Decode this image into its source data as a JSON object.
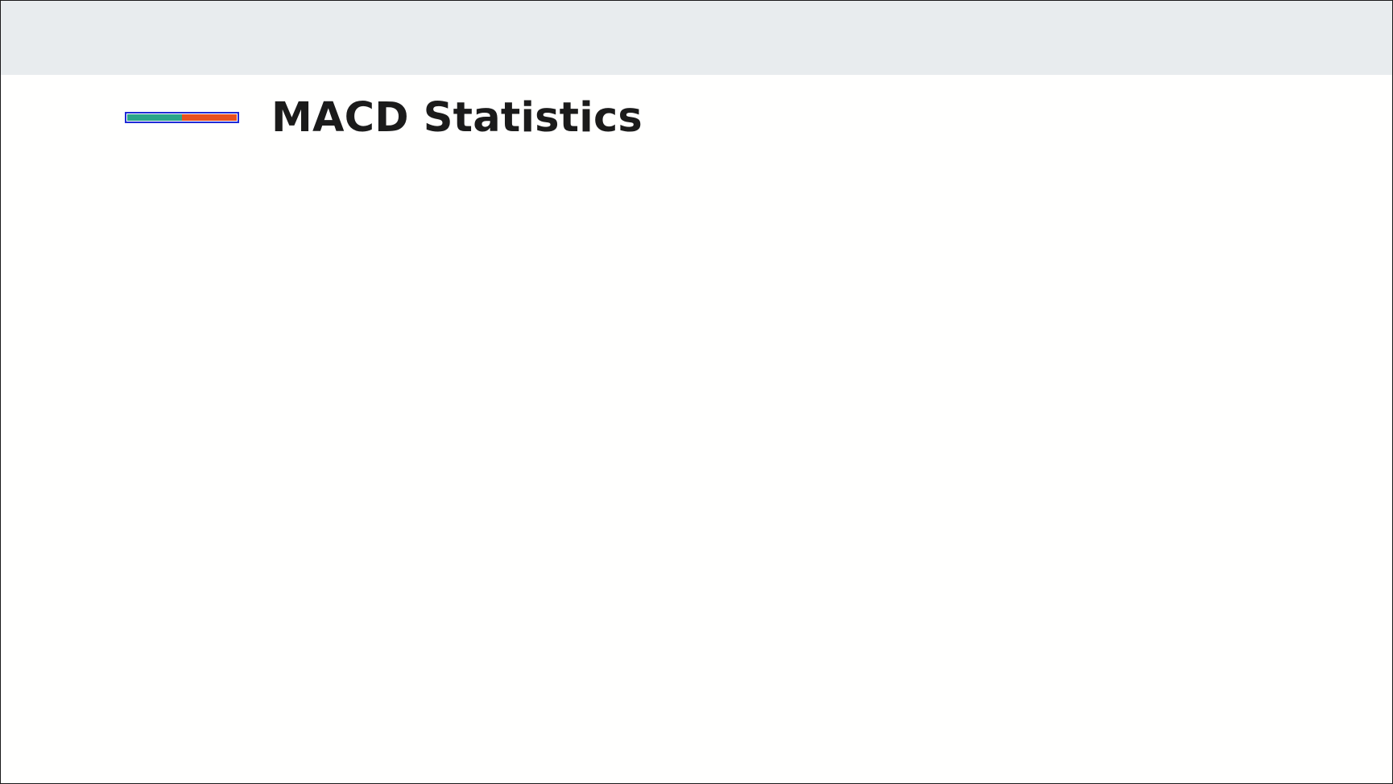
{
  "header": {
    "title": "MACD Statistics",
    "legend_colors": {
      "left": "#2aa58a",
      "right": "#e8501e",
      "border": "#1f2bd6"
    }
  },
  "colors": {
    "top_bar": "#e8ecee",
    "background": "#fffffe",
    "title_text": "#1b1b1b"
  }
}
